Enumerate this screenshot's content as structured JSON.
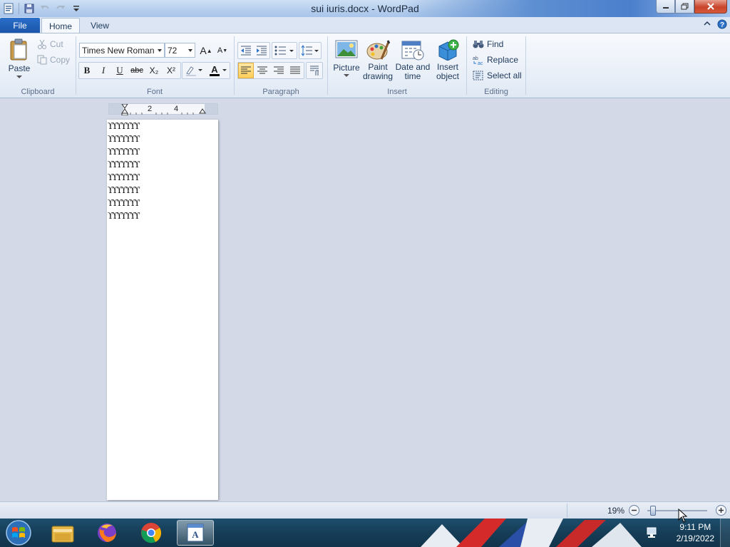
{
  "window": {
    "title": "sui iuris.docx - WordPad",
    "app_icon": "wordpad-icon",
    "qat_icons": [
      "save-icon",
      "undo-icon",
      "redo-icon",
      "customize-dropdown-icon"
    ]
  },
  "ribbon": {
    "tabs": {
      "file": "File",
      "home": "Home",
      "view": "View"
    },
    "clipboard": {
      "paste": "Paste",
      "cut": "Cut",
      "copy": "Copy",
      "group": "Clipboard"
    },
    "font": {
      "family": "Times New Roman",
      "size": "72",
      "group": "Font",
      "buttons": {
        "bold": "B",
        "italic": "I",
        "underline": "U",
        "strike": "abc",
        "subscript": "X₂",
        "superscript": "X²"
      }
    },
    "paragraph": {
      "group": "Paragraph",
      "active_alignment": "left"
    },
    "insert": {
      "group": "Insert",
      "picture": "Picture",
      "paint_drawing_1": "Paint",
      "paint_drawing_2": "drawing",
      "date_time_1": "Date and",
      "date_time_2": "time",
      "insert_object_1": "Insert",
      "insert_object_2": "object"
    },
    "editing": {
      "group": "Editing",
      "find": "Find",
      "replace": "Replace",
      "select_all": "Select all"
    }
  },
  "ruler": {
    "marks": [
      "2",
      "4"
    ]
  },
  "document": {
    "lines": [
      "ϒϒϒϒϒϒϒ",
      "ϒϒϒϒϒϒϒ",
      "ϒϒϒϒϒϒϒ",
      "ϒϒϒϒϒϒϒ",
      "ϒϒϒϒϒϒϒ",
      "ϒϒϒϒϒϒϒ",
      "ϒϒϒϒϒϒϒ",
      "ϒϒϒϒϒϒϒ"
    ]
  },
  "statusbar": {
    "zoom": "19%",
    "zoom_fraction": 0.09
  },
  "taskbar": {
    "items": [
      "start-orb",
      "file-explorer-icon",
      "firefox-icon",
      "chrome-icon",
      "wordpad-icon"
    ],
    "time": "9:11 PM",
    "date": "2/19/2022"
  },
  "colors": {
    "accent": "#1a55aa",
    "active_button": "#ffd05a",
    "taskbar": "#163d57"
  }
}
